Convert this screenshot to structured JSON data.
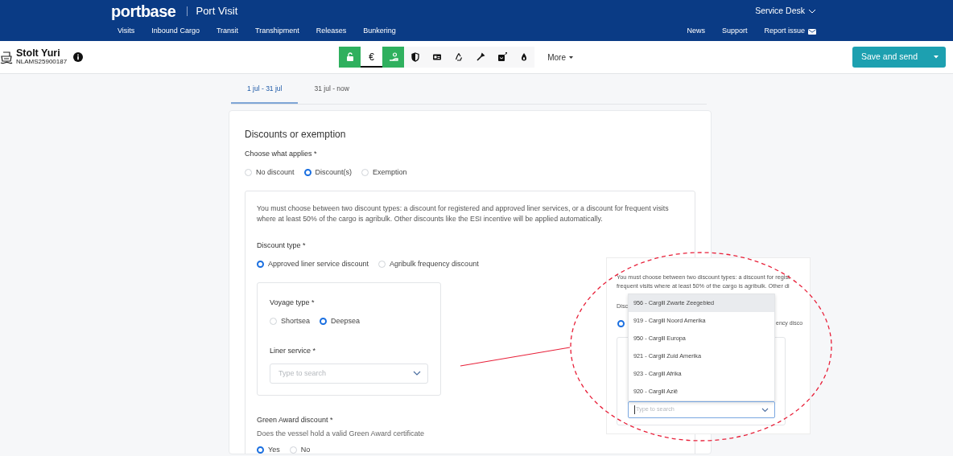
{
  "header": {
    "logo": "portbase",
    "app_title": "Port Visit",
    "service_desk": "Service Desk",
    "nav": [
      "Visits",
      "Inbound Cargo",
      "Transit",
      "Transhipment",
      "Releases",
      "Bunkering"
    ],
    "right_nav": [
      "News",
      "Support"
    ],
    "report_issue": "Report issue"
  },
  "vessel": {
    "name": "Stolt Yuri",
    "code": "NLAMS25900187"
  },
  "toolbar": [
    {
      "done": true,
      "selected": false
    },
    {
      "glyph": "€",
      "done": false,
      "selected": true
    },
    {
      "done": true,
      "selected": false
    },
    {
      "done": false,
      "selected": false
    },
    {
      "done": false,
      "selected": false
    },
    {
      "done": false,
      "selected": false
    },
    {
      "done": false,
      "selected": false
    },
    {
      "done": false,
      "selected": false
    },
    {
      "done": false,
      "selected": false
    }
  ],
  "more_label": "More",
  "save_button": "Save and send",
  "tabs": [
    {
      "label": "1 jul - 31 jul",
      "selected": true
    },
    {
      "label": "31 jul - now",
      "selected": false
    }
  ],
  "form": {
    "title": "Discounts or exemption",
    "applies_label": "Choose what applies *",
    "applies": [
      {
        "label": "No discount",
        "selected": false
      },
      {
        "label": "Discount(s)",
        "selected": true
      },
      {
        "label": "Exemption",
        "selected": false
      }
    ],
    "intro": "You must choose between two discount types: a discount for registered and approved liner services, or a discount for frequent visits where at least 50% of the cargo is agribulk. Other discounts like the ESI incentive will be applied automatically.",
    "discount_type_label": "Discount type *",
    "discount_types": [
      {
        "label": "Approved liner service discount",
        "selected": true
      },
      {
        "label": "Agribulk frequency discount",
        "selected": false
      }
    ],
    "voyage_type_label": "Voyage type *",
    "voyage_types": [
      {
        "label": "Shortsea",
        "selected": false
      },
      {
        "label": "Deepsea",
        "selected": true
      }
    ],
    "liner_service_label": "Liner service *",
    "liner_service_placeholder": "Type to search",
    "green_award_label": "Green Award discount *",
    "green_award_hint": "Does the vessel hold a valid Green Award certificate",
    "green_award": [
      {
        "label": "Yes",
        "selected": true
      },
      {
        "label": "No",
        "selected": false
      }
    ]
  },
  "callout": {
    "intro_lines": [
      "You must choose between two discount types: a discount for regist",
      "frequent visits where at least 50% of the cargo is agribulk. Other di"
    ],
    "label_fragment": "Disc",
    "radio_selected": true,
    "option_fragment": "ency disco",
    "options": [
      {
        "label": "956 - Cargill Zwarte Zeegebied",
        "selected": true
      },
      {
        "label": "919 - Cargill Noord Amerika",
        "selected": false
      },
      {
        "label": "950 - Cargill Europa",
        "selected": false
      },
      {
        "label": "921 - Cargill Zuid Amerika",
        "selected": false
      },
      {
        "label": "923 - Cargill Afrika",
        "selected": false
      },
      {
        "label": "920 - Cargill Azië",
        "selected": false
      }
    ],
    "placeholder": "Type to search"
  }
}
